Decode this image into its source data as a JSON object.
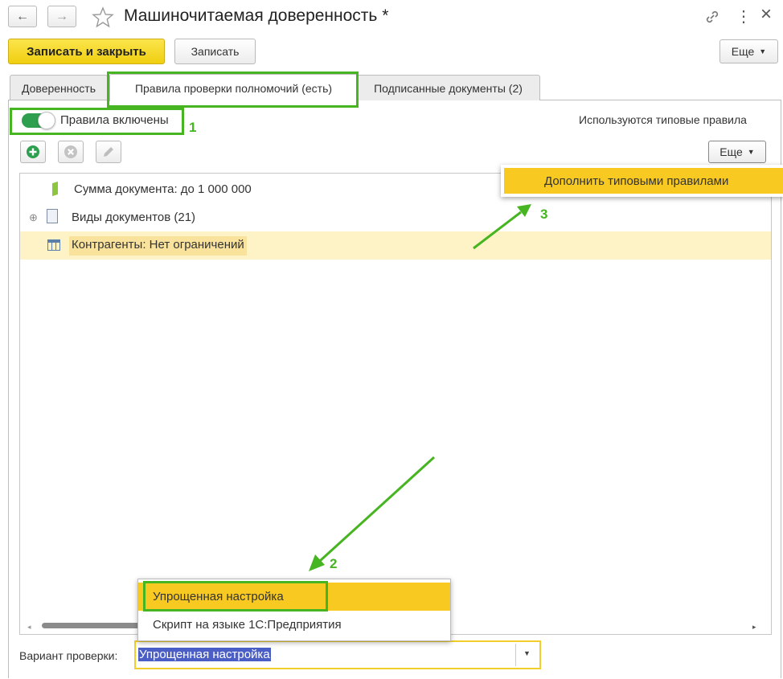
{
  "header": {
    "title": "Машиночитаемая доверенность *",
    "back_glyph": "←",
    "forward_glyph": "→",
    "more_glyph": "⋮",
    "close_glyph": "×"
  },
  "toolbar": {
    "save_close_label": "Записать и закрыть",
    "save_label": "Записать",
    "more_label": "Еще"
  },
  "tabs": [
    {
      "label": "Доверенность"
    },
    {
      "label": "Правила проверки полномочий (есть)"
    },
    {
      "label": "Подписанные документы (2)"
    }
  ],
  "rules": {
    "toggle_label": "Правила включены",
    "toggle_on": true,
    "status_text": "Используются типовые правила",
    "more_label": "Еще",
    "menu_item": "Дополнить типовыми правилами"
  },
  "tree_rows": [
    {
      "label": "Сумма документа: до 1 000 000",
      "icon": "amount-icon"
    },
    {
      "label": "Виды документов (21)",
      "icon": "document-icon",
      "expand": "⊕"
    },
    {
      "label": "Контрагенты: Нет ограничений",
      "icon": "table-icon",
      "selected": true
    }
  ],
  "check_variant": {
    "label": "Вариант проверки:",
    "value": "Упрощенная настройка",
    "options": [
      "Упрощенная настройка",
      "Скрипт на языке 1С:Предприятия"
    ]
  },
  "annotations": [
    "1",
    "2",
    "3"
  ],
  "colors": {
    "accent_green": "#46b521",
    "primary_yellow": "#f7c921",
    "selection_blue": "#4a5ec5",
    "toggle_green": "#2e9e4f"
  }
}
